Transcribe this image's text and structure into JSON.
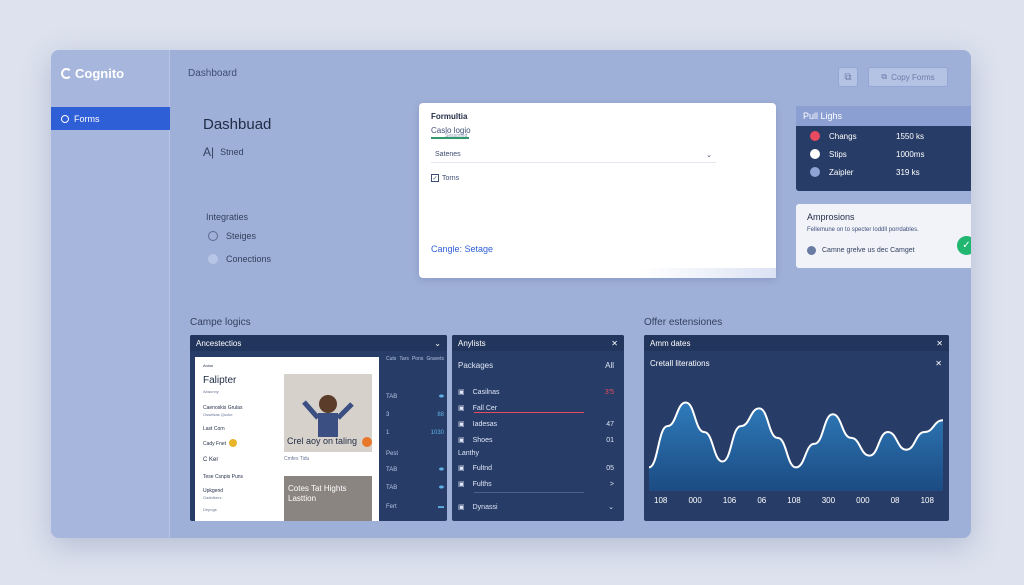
{
  "app": {
    "logo_text": "Cognito"
  },
  "sidebar": {
    "items": [
      {
        "label": "Forms"
      }
    ]
  },
  "header": {
    "title": "Dashboard",
    "copy_button": "Copy Forms"
  },
  "dash": {
    "heading": "Dashbuad",
    "sub_prefix": "A|",
    "sub_label": "Stned",
    "integrations_label": "Integraties",
    "integrations": [
      {
        "label": "Steiges"
      },
      {
        "label": "Conections"
      }
    ]
  },
  "form_card": {
    "title": "Formultia",
    "field_label": "Caslo logio",
    "field_sub": "Sessonnd",
    "select_value": "Satenes",
    "checkbox_label": "Torns",
    "checkbox_checked": true,
    "link": "Cangle: Setage"
  },
  "poll": {
    "title": "Pull Lighs",
    "rows": [
      {
        "label": "Changs",
        "value": "1550 ks",
        "color": "#e84a5f"
      },
      {
        "label": "Stips",
        "value": "1000ms",
        "color": "#ffffff"
      },
      {
        "label": "Zaipler",
        "value": "319 ks",
        "color": "#8fa3d4"
      }
    ]
  },
  "amp": {
    "title": "Amprosions",
    "desc": "Fellemune on to specter loddll porrdables.",
    "user": "Camne grelve us dec Camget",
    "check": "✓"
  },
  "sections": {
    "left": "Campe logics",
    "right": "Offer estensiones"
  },
  "arch": {
    "title": "Ancestectios",
    "doc_tag": "Anion",
    "doc_title": "Falipter",
    "doc_title_sub": "Abaunny",
    "doc_line1": "Caenoskis Grulas",
    "doc_line1_sub": "Ossetkas Qooke",
    "doc_line2": "Last Corn",
    "doc_line3": "Cady Fnet",
    "doc_line4": "C Ker",
    "doc_line5": "Tese Csnpis Puns",
    "doc_line6": "Upkgend",
    "doc_line6_sub": "Gaahlbers",
    "doc_line7": "Depogs",
    "img_caption": "Crel aoy on taling",
    "img_sub": "Cmfes   Tidu",
    "img2_caption": "Cotes Tat Hights Lasttion",
    "side_head": [
      "Cuts",
      "Tars",
      "Pons",
      "Gravets"
    ],
    "side_rows": [
      {
        "a": "TAB",
        "b": ""
      },
      {
        "a": "3",
        "b": "88"
      },
      {
        "a": "1",
        "b": "1030"
      },
      {
        "a": "Pest",
        "b": ""
      },
      {
        "a": "TAB",
        "b": ""
      },
      {
        "a": "TAB",
        "b": ""
      },
      {
        "a": "Fert",
        "b": ""
      }
    ]
  },
  "analysis": {
    "title": "Anylists",
    "packages": "Packages",
    "packages_right": "All",
    "rows": [
      {
        "label": "Casilnas",
        "right": "3'5"
      },
      {
        "label": "Fall Cer",
        "right": ""
      },
      {
        "label": "Iadesas",
        "right": "47"
      },
      {
        "label": "Shoes",
        "right": "01"
      },
      {
        "label": "Lanthy",
        "right": ""
      },
      {
        "label": "Fultnd",
        "right": "05"
      },
      {
        "label": "Fulths",
        "right": ">"
      },
      {
        "label": "Dynassi",
        "right": ""
      }
    ]
  },
  "chart_panel": {
    "title": "Amm dates",
    "subtitle": "Cretall literations"
  },
  "chart_data": {
    "type": "area",
    "title": "",
    "x": [
      "108",
      "000",
      "106",
      "06",
      "108",
      "300",
      "000",
      "08",
      "108"
    ],
    "values": [
      20,
      55,
      75,
      50,
      25,
      55,
      70,
      45,
      20,
      40,
      65,
      45,
      30,
      50,
      35,
      50,
      60
    ],
    "ylim": [
      0,
      100
    ],
    "color": "#2f7fc0"
  },
  "colors": {
    "accent": "#2f5fd6",
    "panel": "#273c66",
    "success": "#21b771"
  }
}
